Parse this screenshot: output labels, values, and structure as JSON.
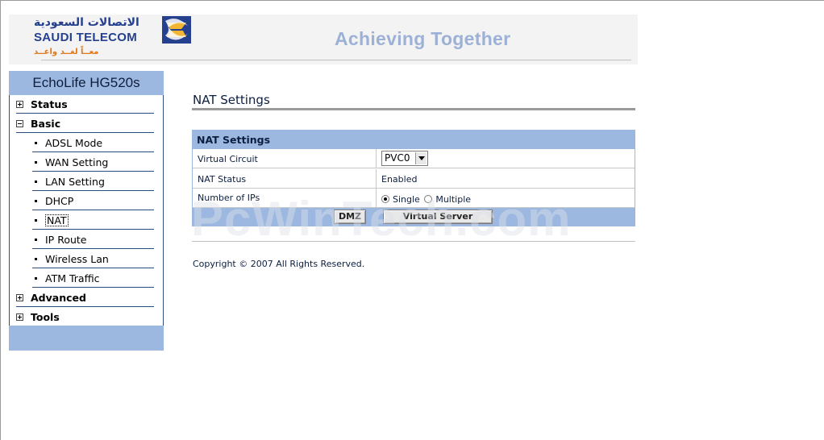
{
  "header": {
    "logo_arabic": "الاتصالات السعودية",
    "logo_english": "SAUDI TELECOM",
    "logo_tagline": "معــاً لغــد واعــد",
    "slogan": "Achieving Together"
  },
  "sidebar": {
    "device_name": "EchoLife HG520s",
    "items": [
      {
        "label": "Status",
        "type": "group",
        "state": "collapsed"
      },
      {
        "label": "Basic",
        "type": "group",
        "state": "expanded"
      },
      {
        "label": "ADSL Mode",
        "type": "sub"
      },
      {
        "label": "WAN Setting",
        "type": "sub"
      },
      {
        "label": "LAN Setting",
        "type": "sub"
      },
      {
        "label": "DHCP",
        "type": "sub"
      },
      {
        "label": "NAT",
        "type": "sub",
        "selected": true
      },
      {
        "label": "IP Route",
        "type": "sub"
      },
      {
        "label": "Wireless Lan",
        "type": "sub"
      },
      {
        "label": "ATM Traffic",
        "type": "sub"
      },
      {
        "label": "Advanced",
        "type": "group",
        "state": "collapsed"
      },
      {
        "label": "Tools",
        "type": "group",
        "state": "collapsed"
      }
    ]
  },
  "main": {
    "title": "NAT Settings",
    "panel_title": "NAT Settings",
    "virtual_circuit": {
      "label": "Virtual Circuit",
      "value": "PVC0"
    },
    "nat_status": {
      "label": "NAT Status",
      "value": "Enabled"
    },
    "number_of_ips": {
      "label": "Number of IPs",
      "options": [
        {
          "label": "Single",
          "checked": true
        },
        {
          "label": "Multiple",
          "checked": false
        }
      ]
    },
    "buttons": {
      "dmz": "DMZ",
      "virtual_server": "Virtual Server"
    },
    "copyright": "Copyright © 2007 All Rights Reserved."
  },
  "watermark": "PcWinTech.com",
  "colors": {
    "accent": "#9db8e0",
    "nav_text": "#0c1f40",
    "slogan": "#9db1d6"
  }
}
